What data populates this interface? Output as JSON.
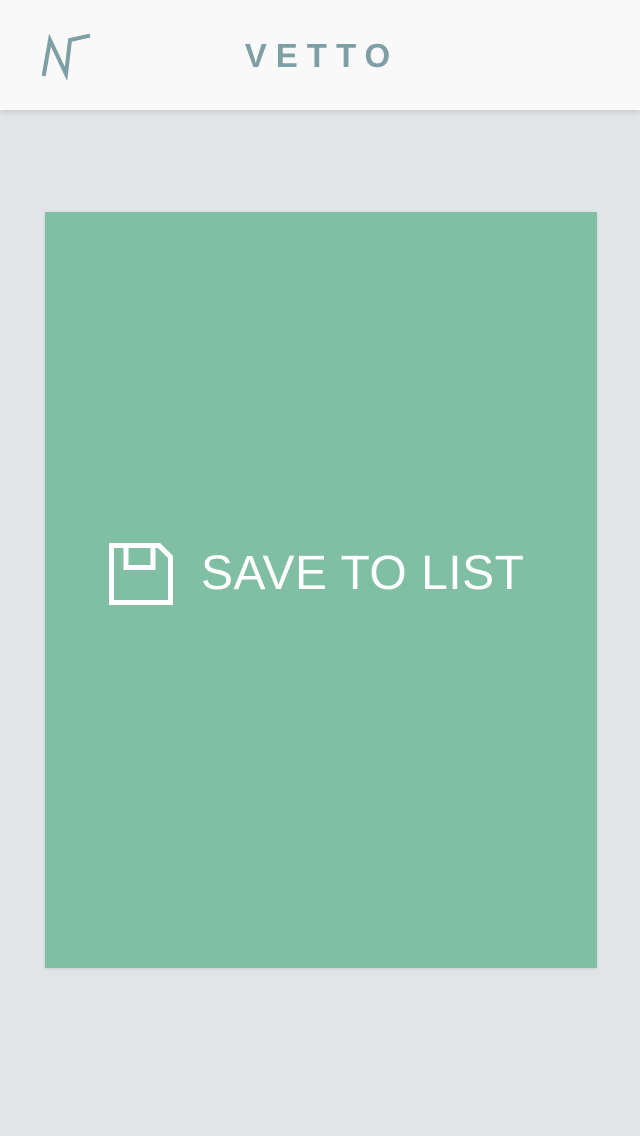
{
  "header": {
    "title": "VETTO",
    "logo_icon": "vetto-logo-icon",
    "title_color": "#7e9fa3",
    "background": "#f9f9f9"
  },
  "card": {
    "action_label": "SAVE TO LIST",
    "action_icon": "floppy-disk-save-icon",
    "background": "#80bfa3",
    "text_color": "#ffffff"
  },
  "page": {
    "background": "#e1e5e7"
  }
}
